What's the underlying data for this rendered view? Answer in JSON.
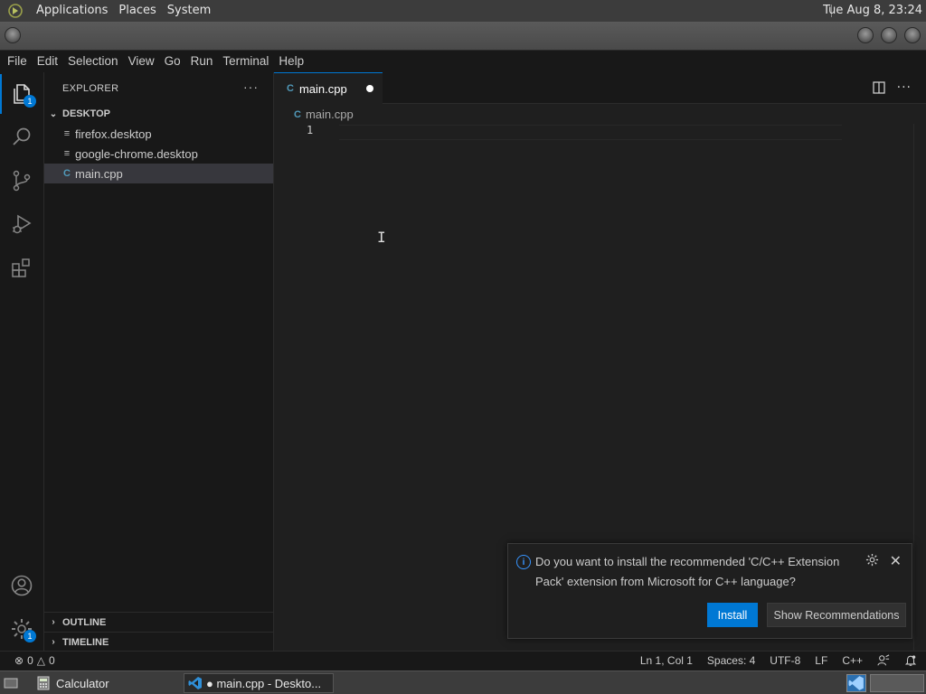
{
  "top_panel": {
    "menus": [
      "Applications",
      "Places",
      "System"
    ],
    "clock": "Tue Aug  8, 23:24"
  },
  "menubar": {
    "items": [
      "File",
      "Edit",
      "Selection",
      "View",
      "Go",
      "Run",
      "Terminal",
      "Help"
    ]
  },
  "activity_bar": {
    "explorer_badge": "1",
    "manage_badge": "1"
  },
  "sidebar": {
    "title": "EXPLORER",
    "more": "···",
    "folder": "DESKTOP",
    "files": [
      {
        "name": "firefox.desktop",
        "icon": "lines-icon"
      },
      {
        "name": "google-chrome.desktop",
        "icon": "lines-icon"
      },
      {
        "name": "main.cpp",
        "icon": "cpp-icon"
      }
    ],
    "outline": "OUTLINE",
    "timeline": "TIMELINE"
  },
  "editor": {
    "tab_label": "main.cpp",
    "breadcrumb": "main.cpp",
    "line_number": "1",
    "file_icon_glyph": "C"
  },
  "notification": {
    "info_glyph": "i",
    "message": "Do you want to install the recommended 'C/C++ Extension Pack' extension from Microsoft for C++ language?",
    "install_label": "Install",
    "recommendations_label": "Show Recommendations"
  },
  "statusbar": {
    "errors": "0",
    "warnings": "0",
    "position": "Ln 1, Col 1",
    "spaces": "Spaces: 4",
    "encoding": "UTF-8",
    "eol": "LF",
    "language": "C++"
  },
  "taskbar": {
    "calculator": "Calculator",
    "vscode": "● main.cpp - Deskto..."
  },
  "colors": {
    "accent": "#0078d4",
    "cpp_icon": "#519aba",
    "info": "#3794ff"
  }
}
